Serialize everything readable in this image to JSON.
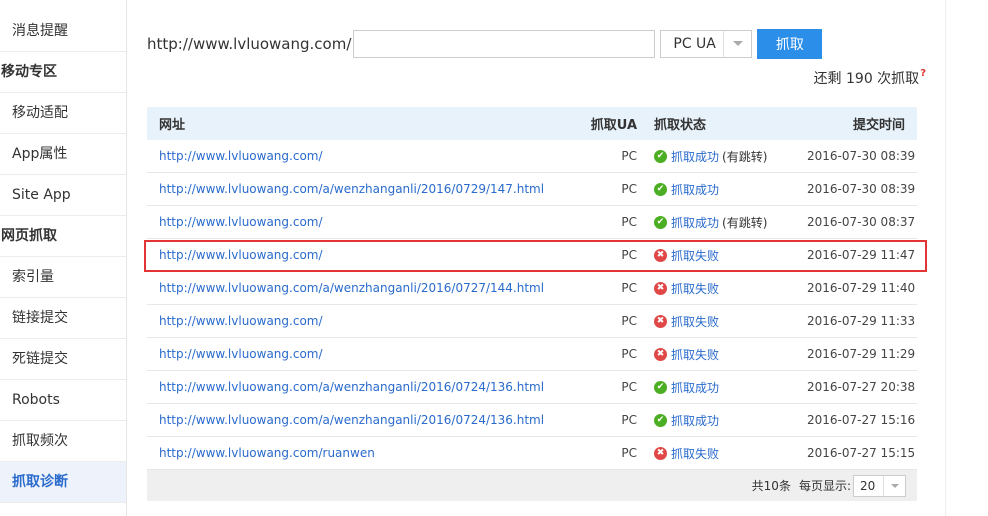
{
  "sidebar": {
    "items": [
      {
        "label": "消息提醒",
        "type": "item"
      },
      {
        "label": "移动专区",
        "type": "section"
      },
      {
        "label": "移动适配",
        "type": "item"
      },
      {
        "label": "App属性",
        "type": "item"
      },
      {
        "label": "Site App",
        "type": "item"
      },
      {
        "label": "网页抓取",
        "type": "section"
      },
      {
        "label": "索引量",
        "type": "item"
      },
      {
        "label": "链接提交",
        "type": "item"
      },
      {
        "label": "死链提交",
        "type": "item"
      },
      {
        "label": "Robots",
        "type": "item"
      },
      {
        "label": "抓取频次",
        "type": "item"
      },
      {
        "label": "抓取诊断",
        "type": "item",
        "active": true
      }
    ]
  },
  "form": {
    "url_prefix": "http://www.lvluowang.com/",
    "url_value": "",
    "ua_selected": "PC UA",
    "submit_label": "抓取"
  },
  "remaining": {
    "text": "还剩 190 次抓取",
    "help": "?"
  },
  "table": {
    "headers": {
      "url": "网址",
      "ua": "抓取UA",
      "status": "抓取状态",
      "time": "提交时间"
    },
    "rows": [
      {
        "url": "http://www.lvluowang.com/",
        "ua": "PC",
        "status": "抓取成功",
        "extra": "(有跳转)",
        "ok": true,
        "time": "2016-07-30 08:39"
      },
      {
        "url": "http://www.lvluowang.com/a/wenzhanganli/2016/0729/147.html",
        "ua": "PC",
        "status": "抓取成功",
        "extra": "",
        "ok": true,
        "time": "2016-07-30 08:39"
      },
      {
        "url": "http://www.lvluowang.com/",
        "ua": "PC",
        "status": "抓取成功",
        "extra": "(有跳转)",
        "ok": true,
        "time": "2016-07-30 08:37"
      },
      {
        "url": "http://www.lvluowang.com/",
        "ua": "PC",
        "status": "抓取失败",
        "extra": "",
        "ok": false,
        "time": "2016-07-29 11:47"
      },
      {
        "url": "http://www.lvluowang.com/a/wenzhanganli/2016/0727/144.html",
        "ua": "PC",
        "status": "抓取失败",
        "extra": "",
        "ok": false,
        "time": "2016-07-29 11:40"
      },
      {
        "url": "http://www.lvluowang.com/",
        "ua": "PC",
        "status": "抓取失败",
        "extra": "",
        "ok": false,
        "time": "2016-07-29 11:33"
      },
      {
        "url": "http://www.lvluowang.com/",
        "ua": "PC",
        "status": "抓取失败",
        "extra": "",
        "ok": false,
        "time": "2016-07-29 11:29"
      },
      {
        "url": "http://www.lvluowang.com/a/wenzhanganli/2016/0724/136.html",
        "ua": "PC",
        "status": "抓取成功",
        "extra": "",
        "ok": true,
        "time": "2016-07-27 20:38"
      },
      {
        "url": "http://www.lvluowang.com/a/wenzhanganli/2016/0724/136.html",
        "ua": "PC",
        "status": "抓取成功",
        "extra": "",
        "ok": true,
        "time": "2016-07-27 15:16"
      },
      {
        "url": "http://www.lvluowang.com/ruanwen",
        "ua": "PC",
        "status": "抓取失败",
        "extra": "",
        "ok": false,
        "time": "2016-07-27 15:15"
      }
    ],
    "footer": {
      "total": "共10条",
      "per_page_label": "每页显示:",
      "per_page_value": "20"
    }
  },
  "colors": {
    "accent": "#2b8ee8",
    "link": "#2a6bcd",
    "success": "#4cae22",
    "fail": "#e04848",
    "highlight": "#e33535"
  },
  "icons": {
    "success": "check-circle-icon",
    "fail": "x-circle-icon",
    "dropdown": "chevron-down-icon"
  }
}
